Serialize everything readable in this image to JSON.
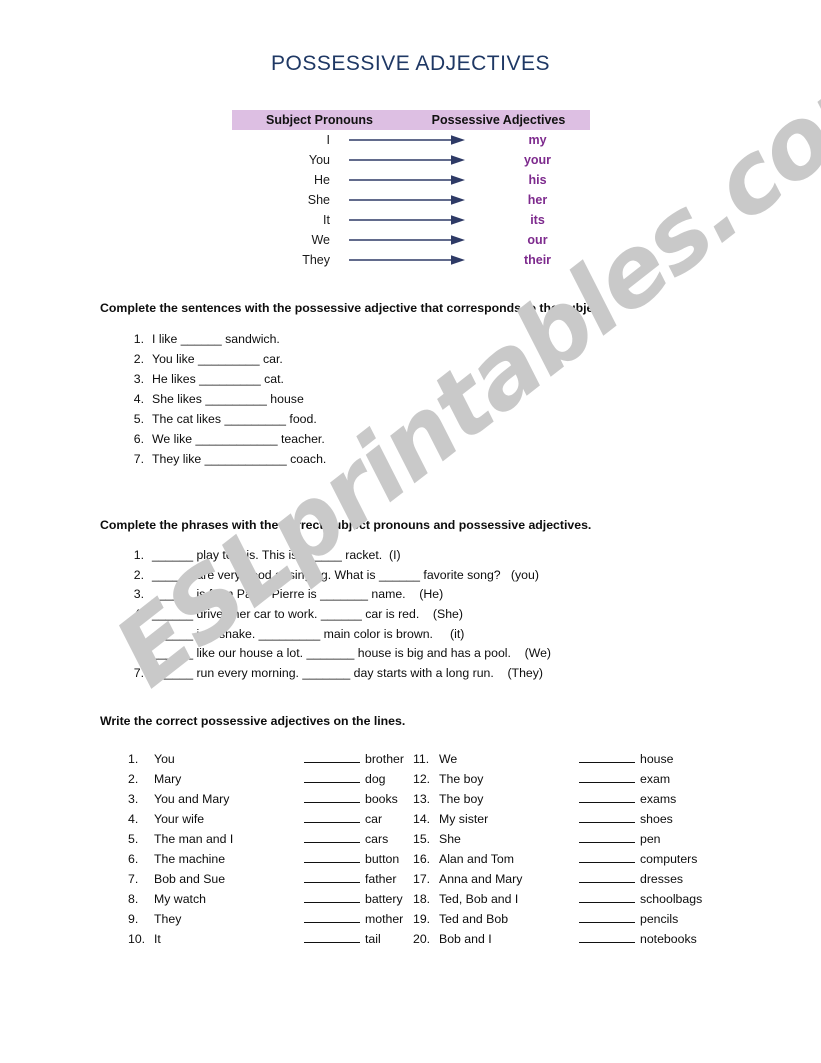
{
  "document": {
    "title": "POSSESSIVE ADJECTIVES"
  },
  "watermark": {
    "text": "ESLprintables.com",
    "color": "#c9c9c9"
  },
  "colors": {
    "title": "#1f3864",
    "table_header_bg": "#ddbfe3",
    "possessive_text": "#7d2a8d",
    "arrow": "#2e3a66"
  },
  "pronoun_table": {
    "header_left": "Subject Pronouns",
    "header_right": "Possessive Adjectives",
    "rows": [
      {
        "pronoun": "I",
        "adjective": "my"
      },
      {
        "pronoun": "You",
        "adjective": "your"
      },
      {
        "pronoun": "He",
        "adjective": "his"
      },
      {
        "pronoun": "She",
        "adjective": "her"
      },
      {
        "pronoun": "It",
        "adjective": "its"
      },
      {
        "pronoun": "We",
        "adjective": "our"
      },
      {
        "pronoun": "They",
        "adjective": "their"
      }
    ]
  },
  "exercise_1": {
    "heading": "Complete the sentences with the possessive adjective that corresponds to the subject.",
    "items": [
      {
        "num": "1.",
        "text": "I like ______ sandwich."
      },
      {
        "num": "2.",
        "text": "You like _________ car."
      },
      {
        "num": "3.",
        "text": "He likes _________ cat."
      },
      {
        "num": "4.",
        "text": "She likes _________ house"
      },
      {
        "num": "5.",
        "text": "The cat likes _________ food."
      },
      {
        "num": "6.",
        "text": "We like ____________ teacher."
      },
      {
        "num": "7.",
        "text": "They like ____________ coach."
      }
    ]
  },
  "exercise_2": {
    "heading": "Complete the phrases with the correct subject pronouns and possessive adjectives.",
    "items": [
      {
        "num": "1.",
        "text": "______ play tennis. This is ______ racket.  (I)"
      },
      {
        "num": "2.",
        "text": "______ are very good at singing. What is ______ favorite song?   (you)"
      },
      {
        "num": "3.",
        "text": "______ is from Paris. Pierre is _______ name.    (He)"
      },
      {
        "num": "4.",
        "text": "______ drives her car to work. ______ car is red.    (She)"
      },
      {
        "num": "5.",
        "text": "______ is a snake. _________ main color is brown.     (it)"
      },
      {
        "num": "6.",
        "text": "______ like our house a lot. _______ house is big and has a pool.    (We)"
      },
      {
        "num": "7.",
        "text": "______ run every morning. _______ day starts with a long run.    (They)"
      }
    ]
  },
  "exercise_3": {
    "heading": "Write the correct possessive adjectives on the lines.",
    "column_left": [
      {
        "num": "1.",
        "subject": "You",
        "noun": "brother"
      },
      {
        "num": "2.",
        "subject": "Mary",
        "noun": "dog"
      },
      {
        "num": "3.",
        "subject": "You and Mary",
        "noun": "books"
      },
      {
        "num": "4.",
        "subject": "Your wife",
        "noun": "car"
      },
      {
        "num": "5.",
        "subject": "The man and I",
        "noun": "cars"
      },
      {
        "num": "6.",
        "subject": "The machine",
        "noun": "button"
      },
      {
        "num": "7.",
        "subject": "Bob and Sue",
        "noun": "father"
      },
      {
        "num": "8.",
        "subject": "My watch",
        "noun": "battery"
      },
      {
        "num": "9.",
        "subject": "They",
        "noun": "mother"
      },
      {
        "num": "10.",
        "subject": "It",
        "noun": "tail"
      }
    ],
    "column_right": [
      {
        "num": "11.",
        "subject": "We",
        "noun": "house"
      },
      {
        "num": "12.",
        "subject": "The boy",
        "noun": "exam"
      },
      {
        "num": "13.",
        "subject": "The boy",
        "noun": "exams"
      },
      {
        "num": "14.",
        "subject": "My sister",
        "noun": "shoes"
      },
      {
        "num": "15.",
        "subject": "She",
        "noun": "pen"
      },
      {
        "num": "16.",
        "subject": "Alan and Tom",
        "noun": "computers"
      },
      {
        "num": "17.",
        "subject": "Anna and Mary",
        "noun": "dresses"
      },
      {
        "num": "18.",
        "subject": "Ted, Bob and I",
        "noun": "schoolbags"
      },
      {
        "num": "19.",
        "subject": "Ted and Bob",
        "noun": "pencils"
      },
      {
        "num": "20.",
        "subject": "Bob and I",
        "noun": "notebooks"
      }
    ]
  }
}
